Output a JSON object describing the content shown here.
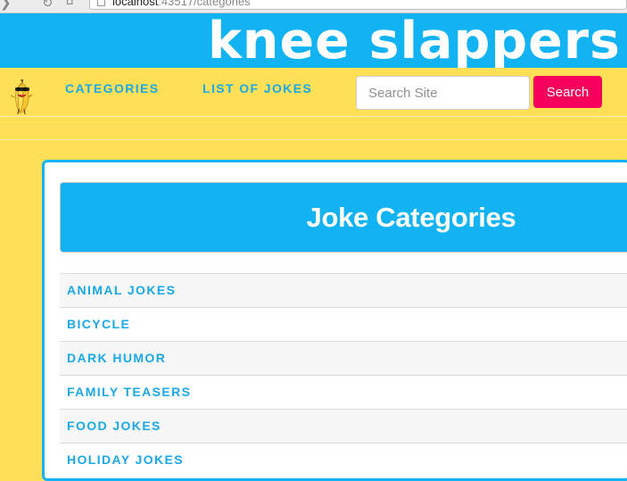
{
  "browser": {
    "url_host": "localhost",
    "url_rest": ":43517/categories"
  },
  "site": {
    "title": "knee slappers"
  },
  "nav": {
    "logo_icon": "banana-mascot-icon",
    "links": [
      "CATEGORIES",
      "LIST OF JOKES"
    ],
    "search": {
      "placeholder": "Search Site",
      "value": "",
      "button_label": "Search"
    }
  },
  "main": {
    "heading": "Joke Categories",
    "categories": [
      "ANIMAL JOKES",
      "BICYCLE",
      "DARK HUMOR",
      "FAMILY TEASERS",
      "FOOD JOKES",
      "HOLIDAY JOKES"
    ]
  },
  "colors": {
    "banner_blue": "#12b3f2",
    "nav_yellow": "#ffdf55",
    "link_blue": "#19a8e8",
    "search_button_pink": "#f5005b"
  }
}
